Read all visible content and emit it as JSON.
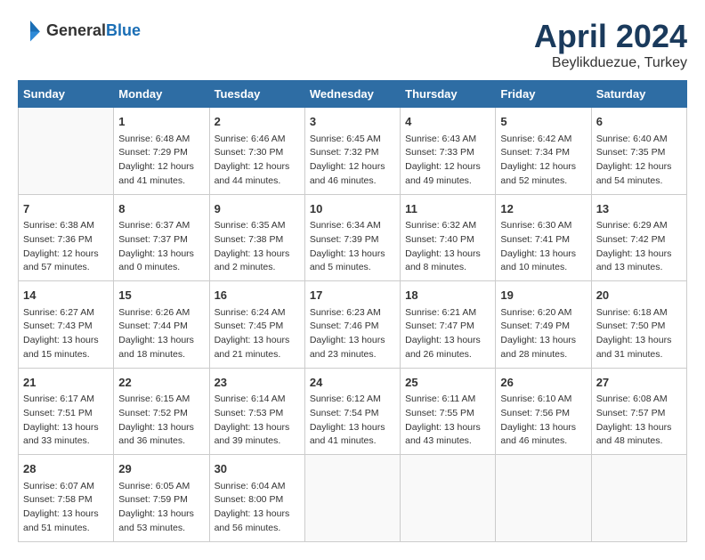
{
  "header": {
    "logo_general": "General",
    "logo_blue": "Blue",
    "title": "April 2024",
    "subtitle": "Beylikduezue, Turkey"
  },
  "calendar": {
    "days_of_week": [
      "Sunday",
      "Monday",
      "Tuesday",
      "Wednesday",
      "Thursday",
      "Friday",
      "Saturday"
    ],
    "weeks": [
      [
        {
          "day": "",
          "sunrise": "",
          "sunset": "",
          "daylight": ""
        },
        {
          "day": "1",
          "sunrise": "Sunrise: 6:48 AM",
          "sunset": "Sunset: 7:29 PM",
          "daylight": "Daylight: 12 hours and 41 minutes."
        },
        {
          "day": "2",
          "sunrise": "Sunrise: 6:46 AM",
          "sunset": "Sunset: 7:30 PM",
          "daylight": "Daylight: 12 hours and 44 minutes."
        },
        {
          "day": "3",
          "sunrise": "Sunrise: 6:45 AM",
          "sunset": "Sunset: 7:32 PM",
          "daylight": "Daylight: 12 hours and 46 minutes."
        },
        {
          "day": "4",
          "sunrise": "Sunrise: 6:43 AM",
          "sunset": "Sunset: 7:33 PM",
          "daylight": "Daylight: 12 hours and 49 minutes."
        },
        {
          "day": "5",
          "sunrise": "Sunrise: 6:42 AM",
          "sunset": "Sunset: 7:34 PM",
          "daylight": "Daylight: 12 hours and 52 minutes."
        },
        {
          "day": "6",
          "sunrise": "Sunrise: 6:40 AM",
          "sunset": "Sunset: 7:35 PM",
          "daylight": "Daylight: 12 hours and 54 minutes."
        }
      ],
      [
        {
          "day": "7",
          "sunrise": "Sunrise: 6:38 AM",
          "sunset": "Sunset: 7:36 PM",
          "daylight": "Daylight: 12 hours and 57 minutes."
        },
        {
          "day": "8",
          "sunrise": "Sunrise: 6:37 AM",
          "sunset": "Sunset: 7:37 PM",
          "daylight": "Daylight: 13 hours and 0 minutes."
        },
        {
          "day": "9",
          "sunrise": "Sunrise: 6:35 AM",
          "sunset": "Sunset: 7:38 PM",
          "daylight": "Daylight: 13 hours and 2 minutes."
        },
        {
          "day": "10",
          "sunrise": "Sunrise: 6:34 AM",
          "sunset": "Sunset: 7:39 PM",
          "daylight": "Daylight: 13 hours and 5 minutes."
        },
        {
          "day": "11",
          "sunrise": "Sunrise: 6:32 AM",
          "sunset": "Sunset: 7:40 PM",
          "daylight": "Daylight: 13 hours and 8 minutes."
        },
        {
          "day": "12",
          "sunrise": "Sunrise: 6:30 AM",
          "sunset": "Sunset: 7:41 PM",
          "daylight": "Daylight: 13 hours and 10 minutes."
        },
        {
          "day": "13",
          "sunrise": "Sunrise: 6:29 AM",
          "sunset": "Sunset: 7:42 PM",
          "daylight": "Daylight: 13 hours and 13 minutes."
        }
      ],
      [
        {
          "day": "14",
          "sunrise": "Sunrise: 6:27 AM",
          "sunset": "Sunset: 7:43 PM",
          "daylight": "Daylight: 13 hours and 15 minutes."
        },
        {
          "day": "15",
          "sunrise": "Sunrise: 6:26 AM",
          "sunset": "Sunset: 7:44 PM",
          "daylight": "Daylight: 13 hours and 18 minutes."
        },
        {
          "day": "16",
          "sunrise": "Sunrise: 6:24 AM",
          "sunset": "Sunset: 7:45 PM",
          "daylight": "Daylight: 13 hours and 21 minutes."
        },
        {
          "day": "17",
          "sunrise": "Sunrise: 6:23 AM",
          "sunset": "Sunset: 7:46 PM",
          "daylight": "Daylight: 13 hours and 23 minutes."
        },
        {
          "day": "18",
          "sunrise": "Sunrise: 6:21 AM",
          "sunset": "Sunset: 7:47 PM",
          "daylight": "Daylight: 13 hours and 26 minutes."
        },
        {
          "day": "19",
          "sunrise": "Sunrise: 6:20 AM",
          "sunset": "Sunset: 7:49 PM",
          "daylight": "Daylight: 13 hours and 28 minutes."
        },
        {
          "day": "20",
          "sunrise": "Sunrise: 6:18 AM",
          "sunset": "Sunset: 7:50 PM",
          "daylight": "Daylight: 13 hours and 31 minutes."
        }
      ],
      [
        {
          "day": "21",
          "sunrise": "Sunrise: 6:17 AM",
          "sunset": "Sunset: 7:51 PM",
          "daylight": "Daylight: 13 hours and 33 minutes."
        },
        {
          "day": "22",
          "sunrise": "Sunrise: 6:15 AM",
          "sunset": "Sunset: 7:52 PM",
          "daylight": "Daylight: 13 hours and 36 minutes."
        },
        {
          "day": "23",
          "sunrise": "Sunrise: 6:14 AM",
          "sunset": "Sunset: 7:53 PM",
          "daylight": "Daylight: 13 hours and 39 minutes."
        },
        {
          "day": "24",
          "sunrise": "Sunrise: 6:12 AM",
          "sunset": "Sunset: 7:54 PM",
          "daylight": "Daylight: 13 hours and 41 minutes."
        },
        {
          "day": "25",
          "sunrise": "Sunrise: 6:11 AM",
          "sunset": "Sunset: 7:55 PM",
          "daylight": "Daylight: 13 hours and 43 minutes."
        },
        {
          "day": "26",
          "sunrise": "Sunrise: 6:10 AM",
          "sunset": "Sunset: 7:56 PM",
          "daylight": "Daylight: 13 hours and 46 minutes."
        },
        {
          "day": "27",
          "sunrise": "Sunrise: 6:08 AM",
          "sunset": "Sunset: 7:57 PM",
          "daylight": "Daylight: 13 hours and 48 minutes."
        }
      ],
      [
        {
          "day": "28",
          "sunrise": "Sunrise: 6:07 AM",
          "sunset": "Sunset: 7:58 PM",
          "daylight": "Daylight: 13 hours and 51 minutes."
        },
        {
          "day": "29",
          "sunrise": "Sunrise: 6:05 AM",
          "sunset": "Sunset: 7:59 PM",
          "daylight": "Daylight: 13 hours and 53 minutes."
        },
        {
          "day": "30",
          "sunrise": "Sunrise: 6:04 AM",
          "sunset": "Sunset: 8:00 PM",
          "daylight": "Daylight: 13 hours and 56 minutes."
        },
        {
          "day": "",
          "sunrise": "",
          "sunset": "",
          "daylight": ""
        },
        {
          "day": "",
          "sunrise": "",
          "sunset": "",
          "daylight": ""
        },
        {
          "day": "",
          "sunrise": "",
          "sunset": "",
          "daylight": ""
        },
        {
          "day": "",
          "sunrise": "",
          "sunset": "",
          "daylight": ""
        }
      ]
    ]
  }
}
